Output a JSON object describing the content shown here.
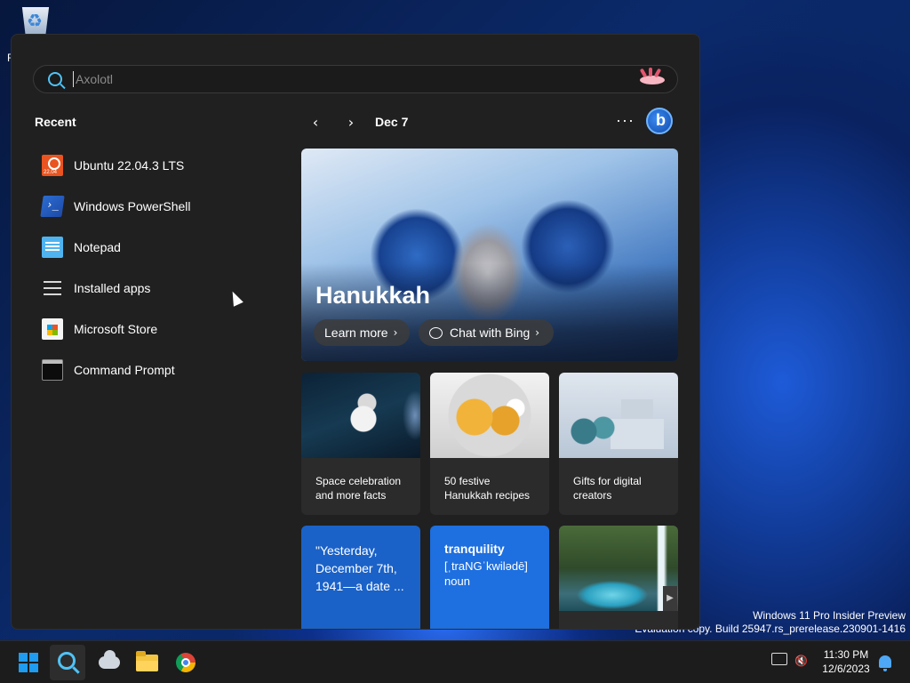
{
  "desktop": {
    "recycle_label": "R"
  },
  "search": {
    "placeholder": "Axolotl",
    "value": ""
  },
  "recent": {
    "title": "Recent",
    "items": [
      {
        "label": "Ubuntu 22.04.3 LTS",
        "icon": "ubuntu-icon"
      },
      {
        "label": "Windows PowerShell",
        "icon": "powershell-icon"
      },
      {
        "label": "Notepad",
        "icon": "notepad-icon"
      },
      {
        "label": "Installed apps",
        "icon": "installed-apps-icon"
      },
      {
        "label": "Microsoft Store",
        "icon": "microsoft-store-icon"
      },
      {
        "label": "Command Prompt",
        "icon": "command-prompt-icon"
      }
    ]
  },
  "nav": {
    "prev": "‹",
    "next": "›",
    "date": "Dec 7",
    "more": "···"
  },
  "hero": {
    "title": "Hanukkah",
    "learn_more": "Learn more",
    "chat_with_bing": "Chat with Bing",
    "chevron": "›"
  },
  "cards": [
    {
      "text": "Space celebration and more facts"
    },
    {
      "text": "50 festive Hanukkah recipes"
    },
    {
      "text": "Gifts for digital creators"
    }
  ],
  "quote_card": {
    "text": "\"Yesterday, December 7th, 1941—a date ..."
  },
  "word_card": {
    "word": "tranquility",
    "pronunciation": "[ˌtraNGˈkwilədē]",
    "part_of_speech": "noun"
  },
  "scroll_arrow": "▶",
  "watermark": {
    "line1": "Windows 11 Pro Insider Preview",
    "line2": "Evaluation copy. Build 25947.rs_prerelease.230901-1416"
  },
  "taskbar": {
    "volume_glyph": "🔇",
    "time": "11:30 PM",
    "date": "12/6/2023"
  },
  "colors": {
    "accent": "#4fc3f7",
    "panel": "#202020",
    "card": "#2b2b2b",
    "taskbar": "#1c1c1c"
  }
}
